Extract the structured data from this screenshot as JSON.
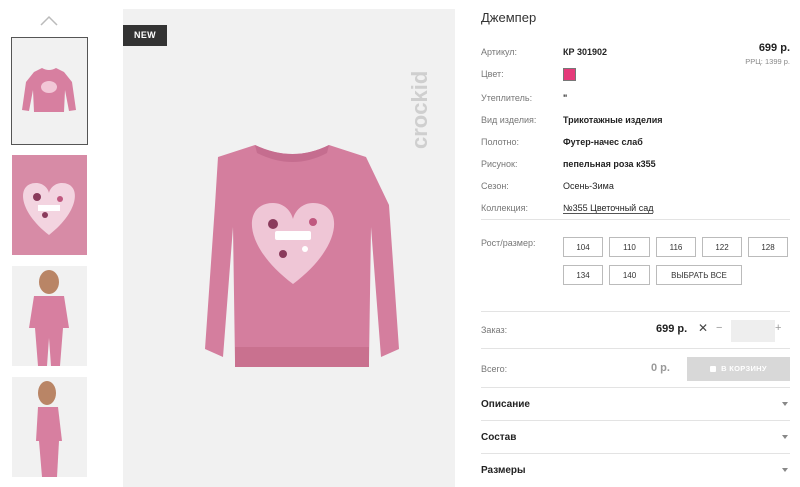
{
  "gallery": {
    "new_badge": "NEW",
    "thumbnails": [
      {
        "label": "thumbnail-1"
      },
      {
        "label": "thumbnail-2"
      },
      {
        "label": "thumbnail-3"
      },
      {
        "label": "thumbnail-4"
      }
    ],
    "brand_logo": "crockid"
  },
  "product": {
    "title": "Джемпер",
    "price": "699 р.",
    "rrp": "РРЦ: 1399 р.",
    "color_hex": "#e53a7a",
    "rows": [
      {
        "label": "Артикул:",
        "value": "КР 301902"
      },
      {
        "label": "Цвет:",
        "value": ""
      },
      {
        "label": "Утеплитель:",
        "value": "\""
      },
      {
        "label": "Вид изделия:",
        "value": "Трикотажные изделия"
      },
      {
        "label": "Полотно:",
        "value": "Футер-начес слаб"
      },
      {
        "label": "Рисунок:",
        "value": "пепельная роза к355"
      },
      {
        "label": "Сезон:",
        "value": "Осень-Зима"
      },
      {
        "label": "Коллекция:",
        "value": "№355 Цветочный сад"
      }
    ]
  },
  "sizes": {
    "label": "Рост/размер:",
    "options": [
      "104",
      "110",
      "116",
      "122",
      "128",
      "134",
      "140"
    ],
    "select_all": "ВЫБРАТЬ ВСЕ"
  },
  "order": {
    "label": "Заказ:",
    "price": "699 р.",
    "times": "✕",
    "minus": "−",
    "plus": "+",
    "qty": ""
  },
  "total": {
    "label": "Всего:",
    "price": "0 р.",
    "cart_button": "В КОРЗИНУ"
  },
  "accordion": [
    "Описание",
    "Состав",
    "Размеры"
  ]
}
